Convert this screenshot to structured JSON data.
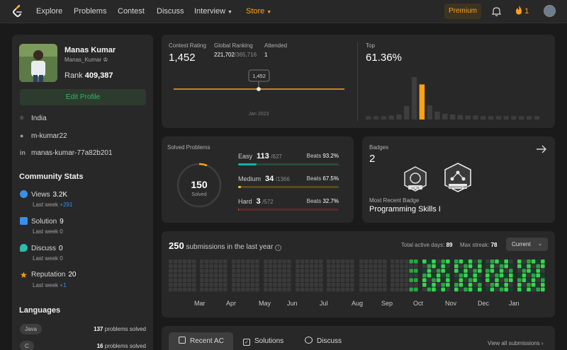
{
  "nav": {
    "items": [
      "Explore",
      "Problems",
      "Contest",
      "Discuss",
      "Interview",
      "Store"
    ],
    "premium": "Premium",
    "streak_count": "1"
  },
  "profile": {
    "name": "Manas Kumar",
    "username": "Manas_Kumar",
    "rank_label": "Rank",
    "rank": "409,387",
    "edit_label": "Edit Profile",
    "location": "India",
    "github": "m-kumar22",
    "linkedin": "manas-kumar-77a82b201"
  },
  "community": {
    "title": "Community Stats",
    "stats": [
      {
        "label": "Views",
        "value": "3.2K",
        "last_week": "Last week",
        "delta": "+291"
      },
      {
        "label": "Solution",
        "value": "9",
        "last_week": "Last week",
        "delta": "0"
      },
      {
        "label": "Discuss",
        "value": "0",
        "last_week": "Last week",
        "delta": "0"
      },
      {
        "label": "Reputation",
        "value": "20",
        "last_week": "Last week",
        "delta": "+1"
      }
    ]
  },
  "languages": {
    "title": "Languages",
    "items": [
      {
        "name": "Java",
        "count": "137",
        "suffix": "problems solved"
      },
      {
        "name": "C",
        "count": "16",
        "suffix": "problems solved"
      }
    ]
  },
  "contest": {
    "rating_label": "Contest Rating",
    "rating": "1,452",
    "global_label": "Global Ranking",
    "global_rank": "221,702",
    "global_total": "/365,716",
    "attended_label": "Attended",
    "attended": "1",
    "tooltip": "1,452",
    "axis_label": "Jan 2023",
    "top_label": "Top",
    "top_value": "61.36%",
    "histogram": [
      0.06,
      0.06,
      0.06,
      0.07,
      0.09,
      0.24,
      0.75,
      0.62,
      0.25,
      0.14,
      0.1,
      0.09,
      0.08,
      0.07,
      0.07,
      0.06,
      0.06,
      0.06,
      0.06,
      0.06,
      0.06,
      0.06,
      0.06
    ],
    "highlight_index": 7
  },
  "solved": {
    "title": "Solved Problems",
    "total": "150",
    "total_label": "Solved",
    "progress_fraction": 0.06,
    "difficulties": [
      {
        "name": "Easy",
        "solved": "113",
        "total": "/627",
        "beats_label": "Beats",
        "beats": "93.2%",
        "fraction": 0.18,
        "color": "#00b8a3",
        "track": "#2a4a3a"
      },
      {
        "name": "Medium",
        "solved": "34",
        "total": "/1366",
        "beats_label": "Beats",
        "beats": "67.5%",
        "fraction": 0.025,
        "color": "#ffc01e",
        "track": "#5a4a1e"
      },
      {
        "name": "Hard",
        "solved": "3",
        "total": "/572",
        "beats_label": "Beats",
        "beats": "32.7%",
        "fraction": 0.005,
        "color": "#ef4743",
        "track": "#5a2a2a"
      }
    ]
  },
  "badges": {
    "title": "Badges",
    "count": "2",
    "badge1_text": "LC 75",
    "badge2_text": "Programming Skills",
    "recent_label": "Most Recent Badge",
    "recent_name": "Programming Skills I"
  },
  "submissions": {
    "count": "250",
    "label": "submissions in the last year",
    "active_label": "Total active days:",
    "active_days": "89",
    "streak_label": "Max streak:",
    "max_streak": "78",
    "filter": "Current",
    "months": [
      "Mar",
      "Apr",
      "May",
      "Jun",
      "Jul",
      "Aug",
      "Sep",
      "Oct",
      "Nov",
      "Dec",
      "Jan"
    ]
  },
  "tabs": {
    "items": [
      "Recent AC",
      "Solutions",
      "Discuss"
    ],
    "view_all": "View all submissions"
  },
  "colors": {
    "accent": "#ffa116",
    "easy": "#00b8a3",
    "medium": "#ffc01e",
    "hard": "#ef4743",
    "green": "#2cbb5d"
  }
}
